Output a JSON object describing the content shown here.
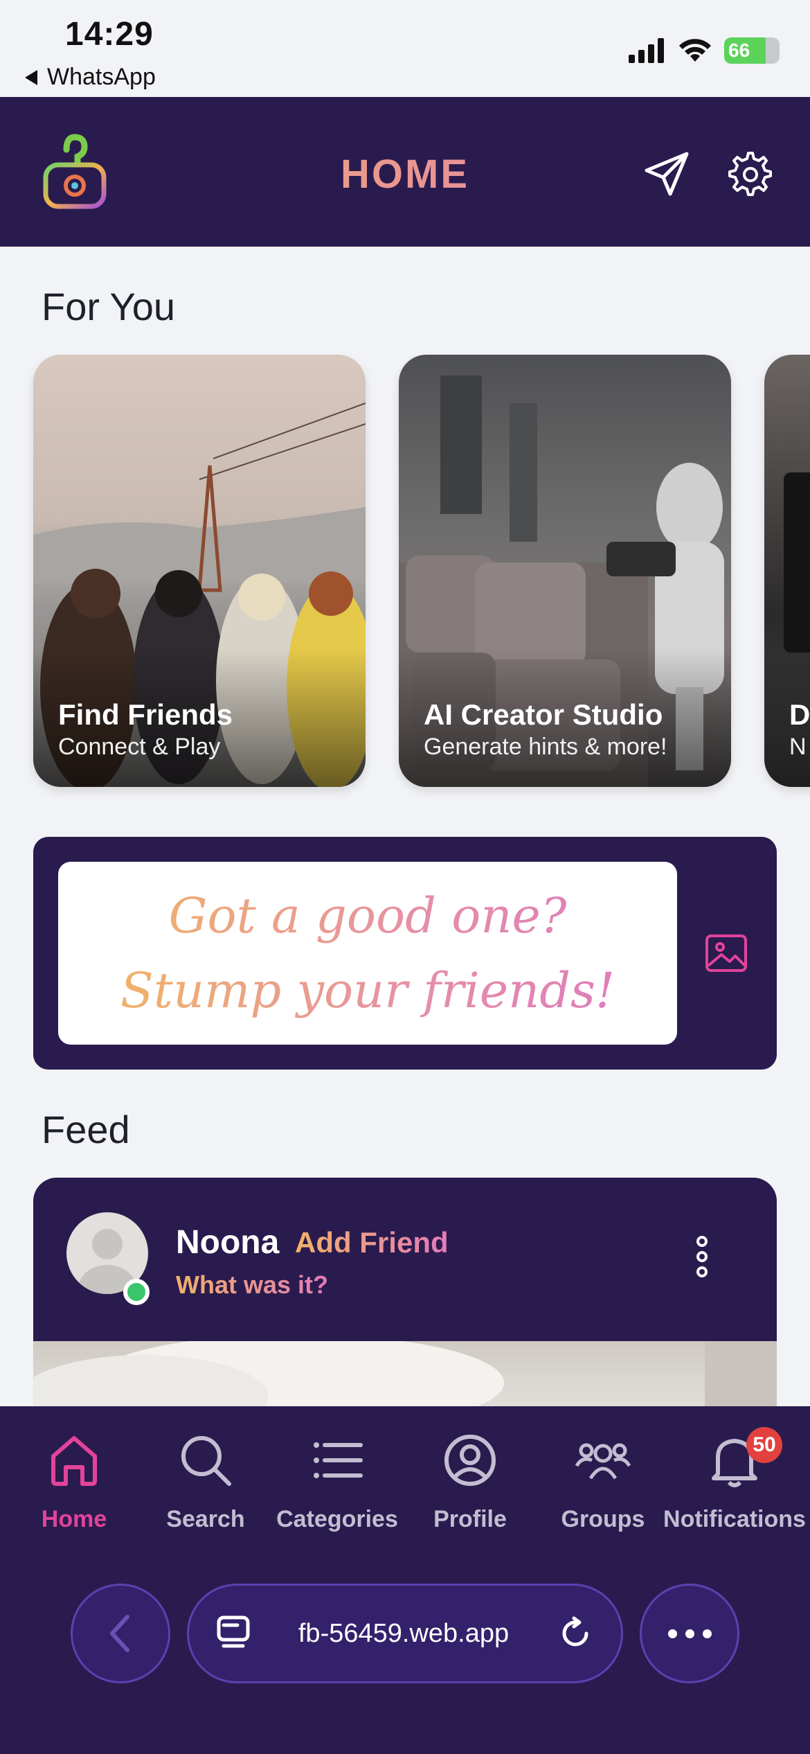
{
  "status_bar": {
    "time": "14:29",
    "back_app": "WhatsApp",
    "battery": "66"
  },
  "header": {
    "title": "HOME",
    "logo_icon": "puzzle-bag-logo",
    "send_icon": "paper-plane-icon",
    "settings_icon": "gear-icon"
  },
  "for_you": {
    "title": "For You",
    "cards": [
      {
        "title": "Find Friends",
        "subtitle": "Connect & Play"
      },
      {
        "title": "AI Creator Studio",
        "subtitle": "Generate hints & more!"
      },
      {
        "title": "D",
        "subtitle": "N"
      }
    ]
  },
  "prompt": {
    "text": "Got a good one? Stump your friends!",
    "image_icon": "image-icon"
  },
  "feed": {
    "title": "Feed",
    "post": {
      "user": "Noona",
      "add_friend": "Add Friend",
      "question": "What was it?"
    }
  },
  "bottom_nav": {
    "items": [
      {
        "label": "Home",
        "icon": "home-icon"
      },
      {
        "label": "Search",
        "icon": "search-icon"
      },
      {
        "label": "Categories",
        "icon": "list-icon"
      },
      {
        "label": "Profile",
        "icon": "profile-icon"
      },
      {
        "label": "Groups",
        "icon": "groups-icon"
      },
      {
        "label": "Notifications",
        "icon": "bell-icon"
      }
    ],
    "notifications_badge": "50"
  },
  "browser": {
    "url": "fb-56459.web.app"
  },
  "colors": {
    "primary": "#2a1b4e",
    "accent_pink": "#e2439b",
    "accent_orange": "#f2b268",
    "background": "#f2f3f6"
  }
}
